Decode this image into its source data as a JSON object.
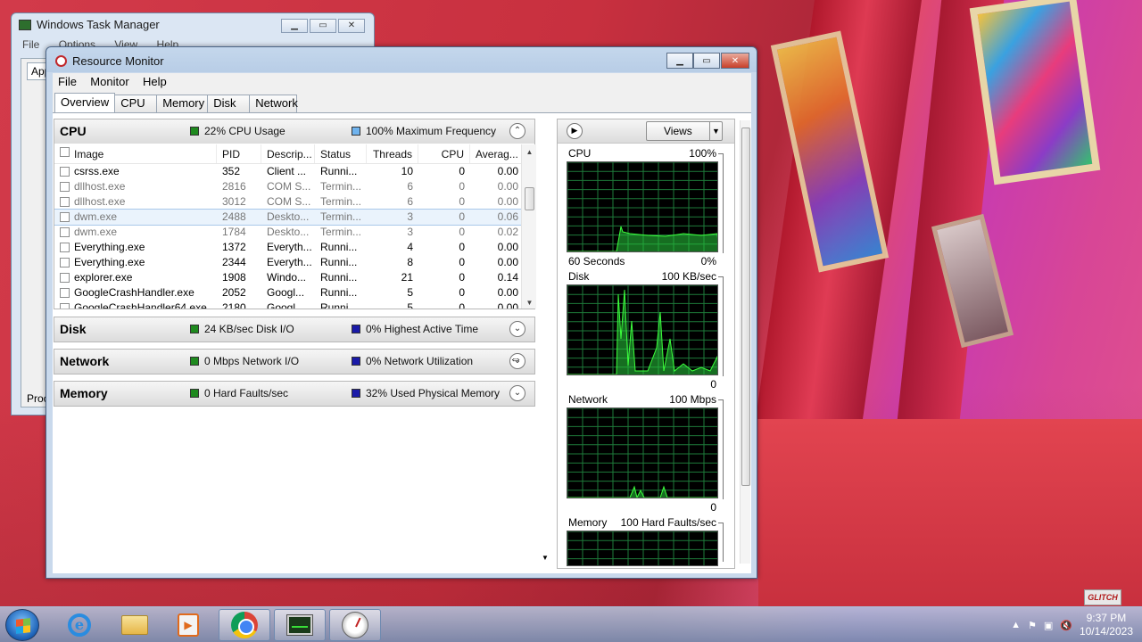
{
  "task_manager": {
    "title": "Windows Task Manager",
    "menu": [
      "File",
      "Options",
      "View",
      "Help"
    ],
    "tab_partial": "App",
    "footer_partial": "Proce"
  },
  "resource_monitor": {
    "title": "Resource Monitor",
    "menu": [
      "File",
      "Monitor",
      "Help"
    ],
    "tabs": [
      "Overview",
      "CPU",
      "Memory",
      "Disk",
      "Network"
    ],
    "active_tab": "Overview",
    "cpu": {
      "name": "CPU",
      "usage_label": "22% CPU Usage",
      "freq_label": "100% Maximum Frequency",
      "usage_color": "#1f8a1f",
      "freq_color": "#6fb3ee",
      "columns": [
        "Image",
        "PID",
        "Descrip...",
        "Status",
        "Threads",
        "CPU",
        "Averag..."
      ],
      "rows": [
        {
          "image": "csrss.exe",
          "pid": "352",
          "desc": "Client ...",
          "status": "Runni...",
          "threads": "10",
          "cpu": "0",
          "avg": "0.00",
          "state": "normal"
        },
        {
          "image": "dllhost.exe",
          "pid": "2816",
          "desc": "COM S...",
          "status": "Termin...",
          "threads": "6",
          "cpu": "0",
          "avg": "0.00",
          "state": "gray"
        },
        {
          "image": "dllhost.exe",
          "pid": "3012",
          "desc": "COM S...",
          "status": "Termin...",
          "threads": "6",
          "cpu": "0",
          "avg": "0.00",
          "state": "gray"
        },
        {
          "image": "dwm.exe",
          "pid": "2488",
          "desc": "Deskto...",
          "status": "Termin...",
          "threads": "3",
          "cpu": "0",
          "avg": "0.06",
          "state": "selected"
        },
        {
          "image": "dwm.exe",
          "pid": "1784",
          "desc": "Deskto...",
          "status": "Termin...",
          "threads": "3",
          "cpu": "0",
          "avg": "0.02",
          "state": "gray"
        },
        {
          "image": "Everything.exe",
          "pid": "1372",
          "desc": "Everyth...",
          "status": "Runni...",
          "threads": "4",
          "cpu": "0",
          "avg": "0.00",
          "state": "normal"
        },
        {
          "image": "Everything.exe",
          "pid": "2344",
          "desc": "Everyth...",
          "status": "Runni...",
          "threads": "8",
          "cpu": "0",
          "avg": "0.00",
          "state": "normal"
        },
        {
          "image": "explorer.exe",
          "pid": "1908",
          "desc": "Windo...",
          "status": "Runni...",
          "threads": "21",
          "cpu": "0",
          "avg": "0.14",
          "state": "normal"
        },
        {
          "image": "GoogleCrashHandler.exe",
          "pid": "2052",
          "desc": "Googl...",
          "status": "Runni...",
          "threads": "5",
          "cpu": "0",
          "avg": "0.00",
          "state": "normal"
        },
        {
          "image": "GoogleCrashHandler64.exe",
          "pid": "2180",
          "desc": "Googl...",
          "status": "Runni...",
          "threads": "5",
          "cpu": "0",
          "avg": "0.00",
          "state": "normal"
        }
      ]
    },
    "disk": {
      "name": "Disk",
      "io_label": "24 KB/sec Disk I/O",
      "active_label": "0% Highest Active Time",
      "io_color": "#1f8a1f",
      "active_color": "#1a1aa8"
    },
    "network": {
      "name": "Network",
      "io_label": "0 Mbps Network I/O",
      "util_label": "0% Network Utilization",
      "io_color": "#1f8a1f",
      "util_color": "#1a1aa8"
    },
    "memory": {
      "name": "Memory",
      "faults_label": "0 Hard Faults/sec",
      "used_label": "32% Used Physical Memory",
      "faults_color": "#1f8a1f",
      "used_color": "#1a1aa8"
    },
    "views_label": "Views",
    "graphs": [
      {
        "title": "CPU",
        "max": "100%",
        "bottom_left": "60 Seconds",
        "bottom_right": "0%"
      },
      {
        "title": "Disk",
        "max": "100 KB/sec",
        "bottom_left": "",
        "bottom_right": "0"
      },
      {
        "title": "Network",
        "max": "100 Mbps",
        "bottom_left": "",
        "bottom_right": "0"
      },
      {
        "title": "Memory",
        "max": "100 Hard Faults/sec",
        "bottom_left": "",
        "bottom_right": ""
      }
    ]
  },
  "taskbar": {
    "clock_time": "9:37 PM",
    "clock_date": "10/14/2023",
    "apps": [
      "internet-explorer",
      "windows-explorer",
      "media-player",
      "google-chrome",
      "task-manager",
      "resource-monitor"
    ]
  },
  "watermark": "GLITCH"
}
